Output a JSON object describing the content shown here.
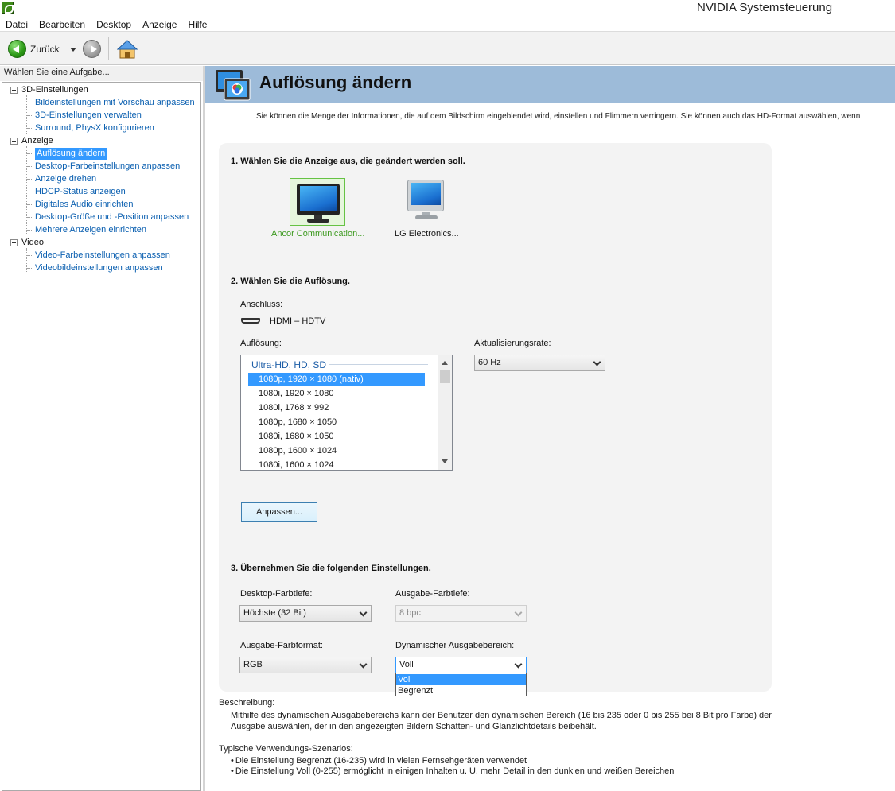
{
  "window": {
    "title": "NVIDIA Systemsteuerung"
  },
  "menu": [
    "Datei",
    "Bearbeiten",
    "Desktop",
    "Anzeige",
    "Hilfe"
  ],
  "toolbar": {
    "back_label": "Zurück"
  },
  "sidebar": {
    "header": "Wählen Sie eine Aufgabe...",
    "groups": [
      {
        "label": "3D-Einstellungen",
        "items": [
          "Bildeinstellungen mit Vorschau anpassen",
          "3D-Einstellungen verwalten",
          "Surround, PhysX konfigurieren"
        ]
      },
      {
        "label": "Anzeige",
        "items": [
          "Auflösung ändern",
          "Desktop-Farbeinstellungen anpassen",
          "Anzeige drehen",
          "HDCP-Status anzeigen",
          "Digitales Audio einrichten",
          "Desktop-Größe und -Position anpassen",
          "Mehrere Anzeigen einrichten"
        ]
      },
      {
        "label": "Video",
        "items": [
          "Video-Farbeinstellungen anpassen",
          "Videobildeinstellungen anpassen"
        ]
      }
    ],
    "selected": "Auflösung ändern"
  },
  "page": {
    "title": "Auflösung ändern",
    "intro": "Sie können die Menge der Informationen, die auf dem Bildschirm eingeblendet wird, einstellen und Flimmern verringern. Sie können auch das HD-Format auswählen, wenn"
  },
  "section1": {
    "title": "1. Wählen Sie die Anzeige aus, die geändert werden soll.",
    "displays": [
      "Ancor Communication...",
      "LG Electronics..."
    ]
  },
  "section2": {
    "title": "2. Wählen Sie die Auflösung.",
    "connector_label": "Anschluss:",
    "connector_value": "HDMI – HDTV",
    "resolution_label": "Auflösung:",
    "group": "Ultra-HD, HD, SD",
    "resolutions": [
      "1080p, 1920 × 1080 (nativ)",
      "1080i, 1920 × 1080",
      "1080i, 1768 × 992",
      "1080p, 1680 × 1050",
      "1080i, 1680 × 1050",
      "1080p, 1600 × 1024",
      "1080i, 1600 × 1024"
    ],
    "refresh_label": "Aktualisierungsrate:",
    "refresh_value": "60 Hz",
    "customize_button": "Anpassen..."
  },
  "section3": {
    "title": "3. Übernehmen Sie die folgenden Einstellungen.",
    "desktop_depth_label": "Desktop-Farbtiefe:",
    "desktop_depth_value": "Höchste (32 Bit)",
    "output_depth_label": "Ausgabe-Farbtiefe:",
    "output_depth_value": "8 bpc",
    "color_format_label": "Ausgabe-Farbformat:",
    "color_format_value": "RGB",
    "dynamic_range_label": "Dynamischer Ausgabebereich:",
    "dynamic_range_value": "Voll",
    "dynamic_range_options": [
      "Voll",
      "Begrenzt"
    ]
  },
  "description": {
    "title": "Beschreibung:",
    "text": "Mithilfe des dynamischen Ausgabebereichs kann der Benutzer den dynamischen Bereich (16 bis 235 oder 0 bis 255 bei 8 Bit pro Farbe) der Ausgabe auswählen, der in den angezeigten Bildern Schatten- und Glanzlichtdetails beibehält.",
    "usage_title": "Typische Verwendungs-Szenarios:",
    "usage": [
      "Die Einstellung Begrenzt (16-235) wird in vielen Fernsehgeräten verwendet",
      "Die Einstellung Voll (0-255) ermöglicht in einigen Inhalten u. U. mehr Detail in den dunklen und weißen Bereichen"
    ]
  },
  "colors": {
    "header_bar": "#9dbbd9",
    "selection": "#3399ff",
    "link": "#0a5fb0",
    "selected_display": "#3c9a1f"
  }
}
